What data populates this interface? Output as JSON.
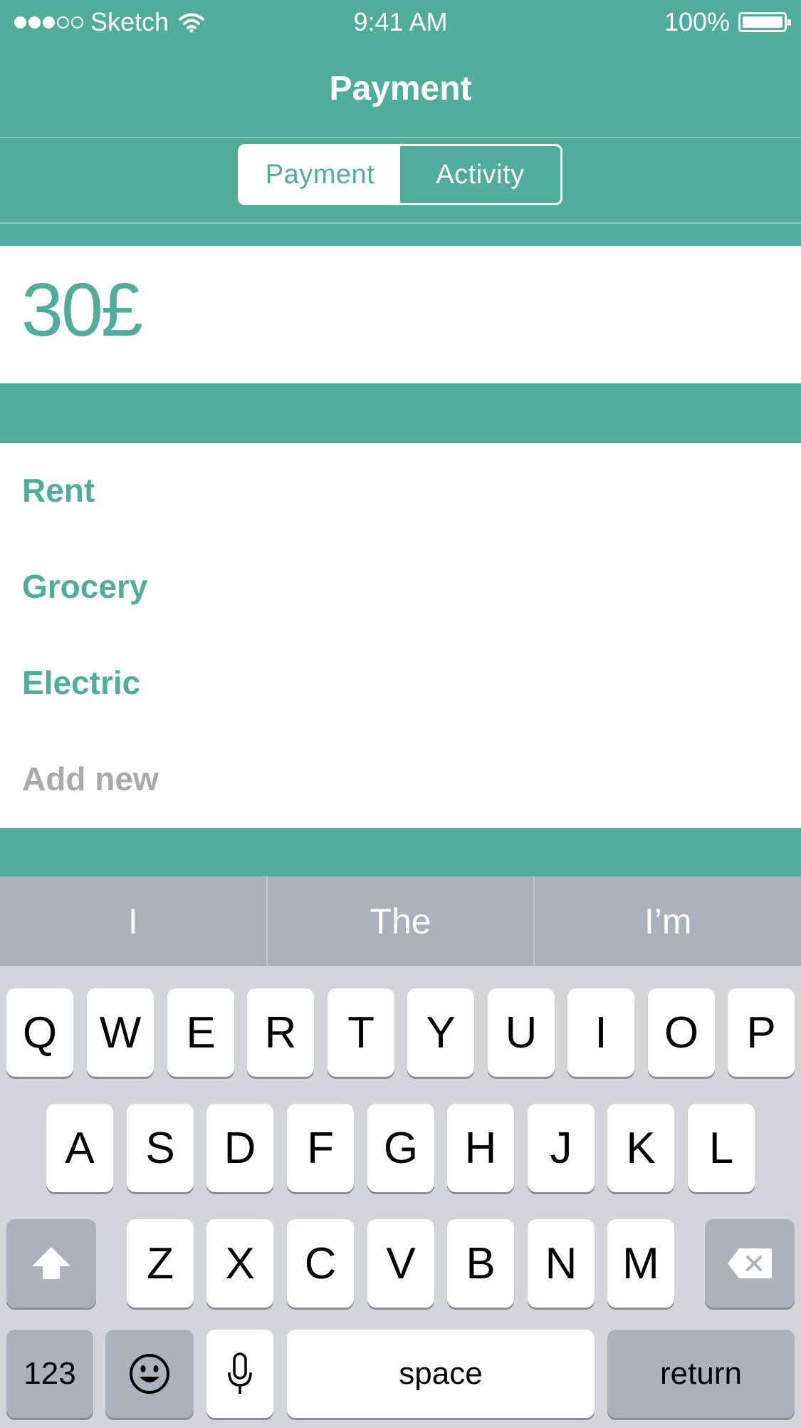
{
  "status_bar": {
    "carrier": "Sketch",
    "time": "9:41 AM",
    "battery": "100%",
    "signal_bars_filled": 3,
    "signal_bars_total": 5
  },
  "nav": {
    "title": "Payment"
  },
  "segmented_control": {
    "tabs": [
      {
        "label": "Payment",
        "selected": true
      },
      {
        "label": "Activity",
        "selected": false
      }
    ]
  },
  "amount": {
    "value": "30£"
  },
  "categories": [
    {
      "label": "Rent",
      "style": "active"
    },
    {
      "label": "Grocery",
      "style": "active"
    },
    {
      "label": "Electric",
      "style": "active"
    },
    {
      "label": "Add new",
      "style": "placeholder"
    }
  ],
  "keyboard": {
    "suggestions": [
      "I",
      "The",
      "I’m"
    ],
    "row1": [
      "Q",
      "W",
      "E",
      "R",
      "T",
      "Y",
      "U",
      "I",
      "O",
      "P"
    ],
    "row2": [
      "A",
      "S",
      "D",
      "F",
      "G",
      "H",
      "J",
      "K",
      "L"
    ],
    "row3": [
      "Z",
      "X",
      "C",
      "V",
      "B",
      "N",
      "M"
    ],
    "numbers_key": "123",
    "space_key": "space",
    "return_key": "return",
    "icons": [
      "shift-icon",
      "delete-icon",
      "emoji-icon",
      "microphone-icon"
    ]
  },
  "colors": {
    "accent": "#50ad9b",
    "placeholder": "#aaaaaa",
    "keyboard_bg": "#d2d5da",
    "suggestion_bg": "#aab1ba"
  }
}
